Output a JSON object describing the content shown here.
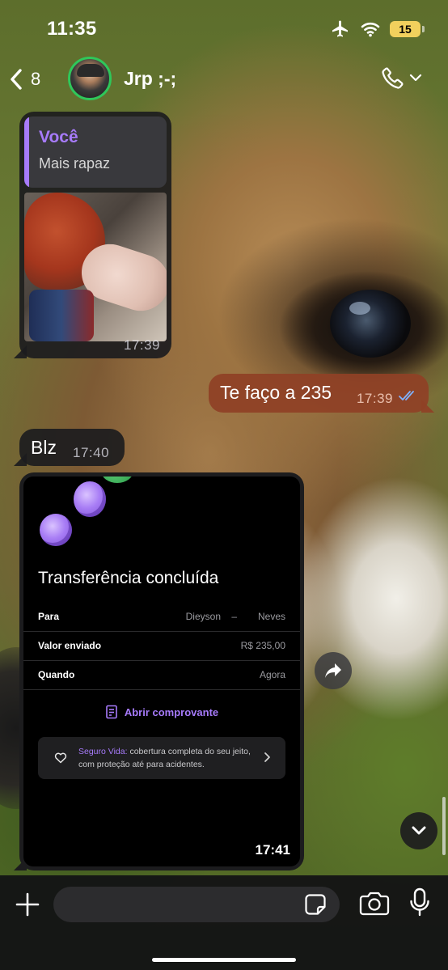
{
  "status_bar": {
    "time": "11:35",
    "battery": "15"
  },
  "header": {
    "back_count": "8",
    "contact_name": "Jrp ;-;"
  },
  "messages": {
    "reply": {
      "quote_author": "Você",
      "quote_text": "Mais rapaz",
      "time": "17:39"
    },
    "outgoing": {
      "text": "Te faço a 235",
      "time": "17:39"
    },
    "blz": {
      "text": "Blz",
      "time": "17:40"
    },
    "transfer": {
      "title": "Transferência concluída",
      "rows": [
        {
          "label": "Para",
          "value_a": "Dieyson",
          "value_b": "Neves"
        },
        {
          "label": "Valor enviado",
          "value": "R$ 235,00"
        },
        {
          "label": "Quando",
          "value": "Agora"
        }
      ],
      "receipt_label": "Abrir comprovante",
      "insurance_highlight": "Seguro Vida:",
      "insurance_text": " cobertura completa do seu jeito, com proteção até para acidentes.",
      "time": "17:41"
    }
  },
  "input": {
    "placeholder": ""
  },
  "colors": {
    "accent": "#a77bfb",
    "outgoing_bubble": "#8f4126",
    "incoming_bubble": "#1c1c1e",
    "online_ring": "#2fc75a",
    "battery": "#f1d05d"
  }
}
